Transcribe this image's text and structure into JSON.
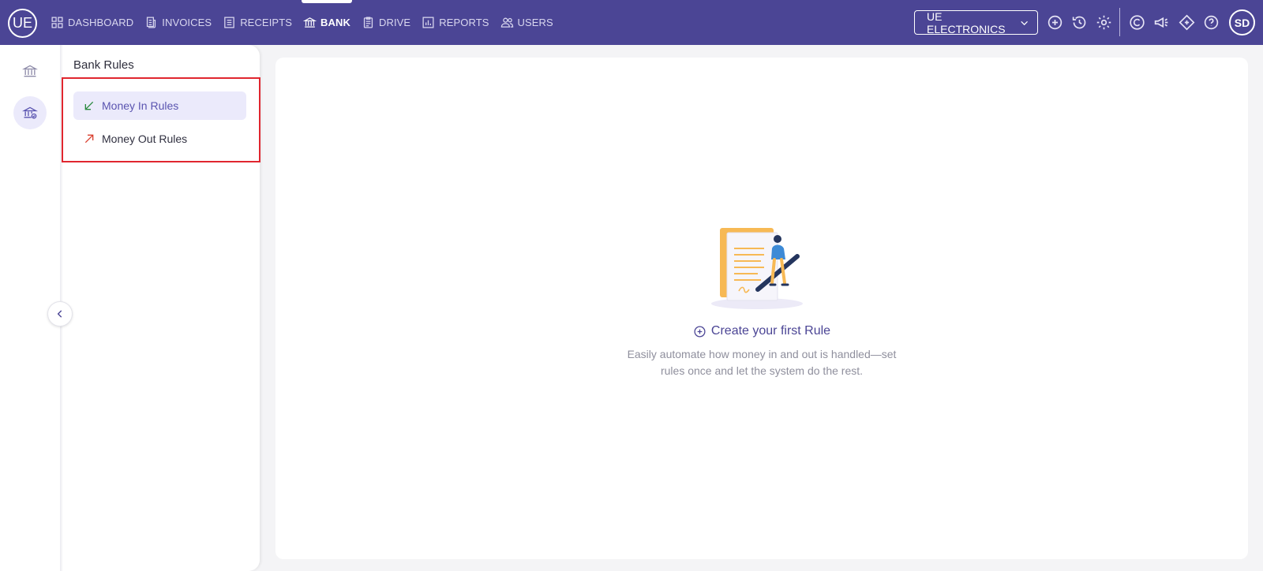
{
  "brand": {
    "initials": "UE"
  },
  "nav": {
    "items": [
      {
        "label": "DASHBOARD",
        "icon": "dashboard-icon"
      },
      {
        "label": "INVOICES",
        "icon": "invoice-icon"
      },
      {
        "label": "RECEIPTS",
        "icon": "receipt-icon"
      },
      {
        "label": "BANK",
        "icon": "bank-icon",
        "active": true
      },
      {
        "label": "DRIVE",
        "icon": "drive-icon"
      },
      {
        "label": "REPORTS",
        "icon": "reports-icon"
      },
      {
        "label": "USERS",
        "icon": "users-icon"
      }
    ]
  },
  "company": {
    "name": "UE ELECTRONICS"
  },
  "toolbar_icons": [
    "add-circle-icon",
    "history-icon",
    "settings-icon",
    "c-logo-icon",
    "announcement-icon",
    "diamond-icon",
    "help-icon"
  ],
  "user": {
    "initials": "SD"
  },
  "rail": {
    "items": [
      "bank-icon",
      "bank-rules-icon"
    ]
  },
  "sidebar": {
    "title": "Bank Rules",
    "items": [
      {
        "label": "Money In Rules",
        "icon": "arrow-down-left-icon",
        "active": true
      },
      {
        "label": "Money Out Rules",
        "icon": "arrow-up-right-icon"
      }
    ]
  },
  "empty_state": {
    "cta": "Create your first Rule",
    "description_line1": "Easily automate how money in and out is handled—set",
    "description_line2": "rules once and let the system do the rest."
  },
  "colors": {
    "topbar": "#4b4595",
    "accent": "#5a54b0",
    "active_bg": "#ebeafb",
    "highlight_border": "#e0262f",
    "money_in": "#2a8a3e",
    "money_out": "#d9402f"
  }
}
